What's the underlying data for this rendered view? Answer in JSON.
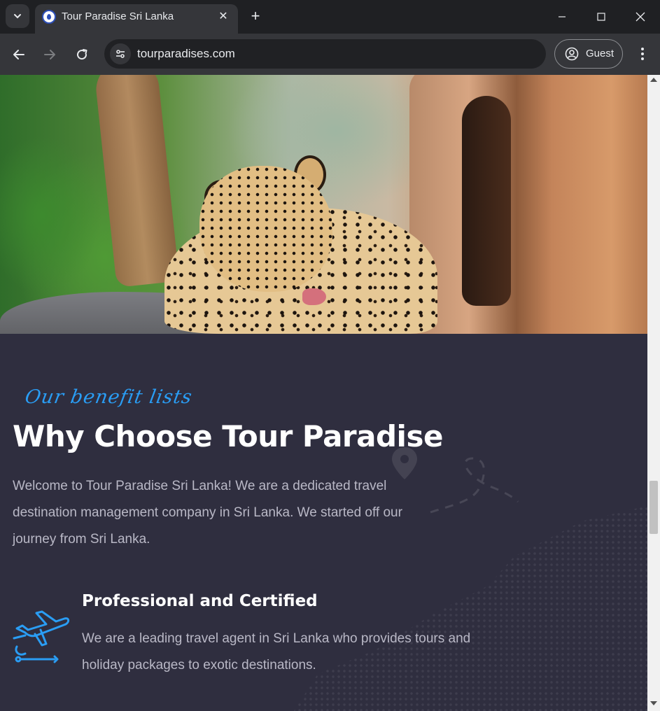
{
  "browser": {
    "tab_title": "Tour Paradise Sri Lanka",
    "url": "tourparadises.com",
    "profile_label": "Guest",
    "new_tab_symbol": "+",
    "tab_close_symbol": "✕"
  },
  "icons": {
    "tab_list": "chevron-down-icon",
    "favicon": "tour-paradise-logo-icon",
    "back": "arrow-left-icon",
    "forward": "arrow-right-icon",
    "reload": "reload-icon",
    "site_info": "tune-icon",
    "profile": "person-circle-icon",
    "menu": "more-vert-icon",
    "feature": "airplane-icon",
    "map_pin": "location-pin-icon"
  },
  "hero": {
    "image": "leopard-in-forest-photo"
  },
  "benefits": {
    "script_heading": "Our benefit lists",
    "heading": "Why Choose Tour Paradise",
    "intro": "Welcome to Tour Paradise Sri Lanka! We are a dedicated travel destination management company in Sri Lanka. We started off our journey from Sri Lanka.",
    "features": [
      {
        "title": "Professional and Certified",
        "description": "We are a leading travel agent in Sri Lanka who provides tours and holiday packages to exotic destinations."
      }
    ]
  },
  "colors": {
    "section_bg": "#2f2e3f",
    "accent": "#2a9df4",
    "heading": "#ffffff",
    "body_text": "#b9b8c6",
    "chrome_dark": "#1f2023",
    "chrome_toolbar": "#35363a"
  }
}
